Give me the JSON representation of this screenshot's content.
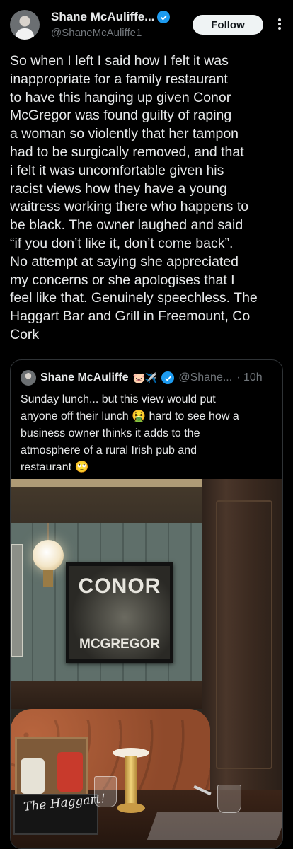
{
  "author": {
    "display_name": "Shane McAuliffe...",
    "handle": "@ShaneMcAuliffe1"
  },
  "actions": {
    "follow_label": "Follow"
  },
  "tweet": {
    "lines": [
      "So when I left I said how I felt it was",
      "inappropriate for a family restaurant",
      "to have this hanging up given Conor",
      "McGregor was found guilty of raping",
      "a woman so violently that her tampon",
      "had to be surgically removed, and that",
      "i felt it was uncomfortable given his",
      "racist views how they have a young",
      "waitress working there who happens to",
      "be black. The owner laughed and said",
      "“if you don’t like it, don’t come back”.",
      "No attempt at saying she appreciated",
      "my concerns or she apologises that I",
      "feel like that. Genuinely speechless. The",
      "Haggart Bar and Grill in Freemount, Co",
      "Cork"
    ]
  },
  "quoted": {
    "name": "Shane McAuliffe",
    "emojis": "🐷✈️",
    "handle": "@Shane...",
    "time": "· 10h",
    "lines": [
      "Sunday lunch... but this view would put",
      "anyone off their lunch 🤮 hard to see how a",
      "business owner thinks it adds to the",
      "atmosphere of a rural Irish pub and",
      "restaurant 🙄"
    ],
    "photo": {
      "poster_line1": "CONOR",
      "poster_line2": "MCGREGOR",
      "chalkboard": "The Haggart!"
    }
  },
  "colors": {
    "background": "#000000",
    "text": "#e7e9ea",
    "secondary": "#71767b",
    "verified": "#1d9bf0",
    "border": "#2f3336"
  },
  "icons": [
    "verified-badge-icon",
    "more-options-icon"
  ]
}
